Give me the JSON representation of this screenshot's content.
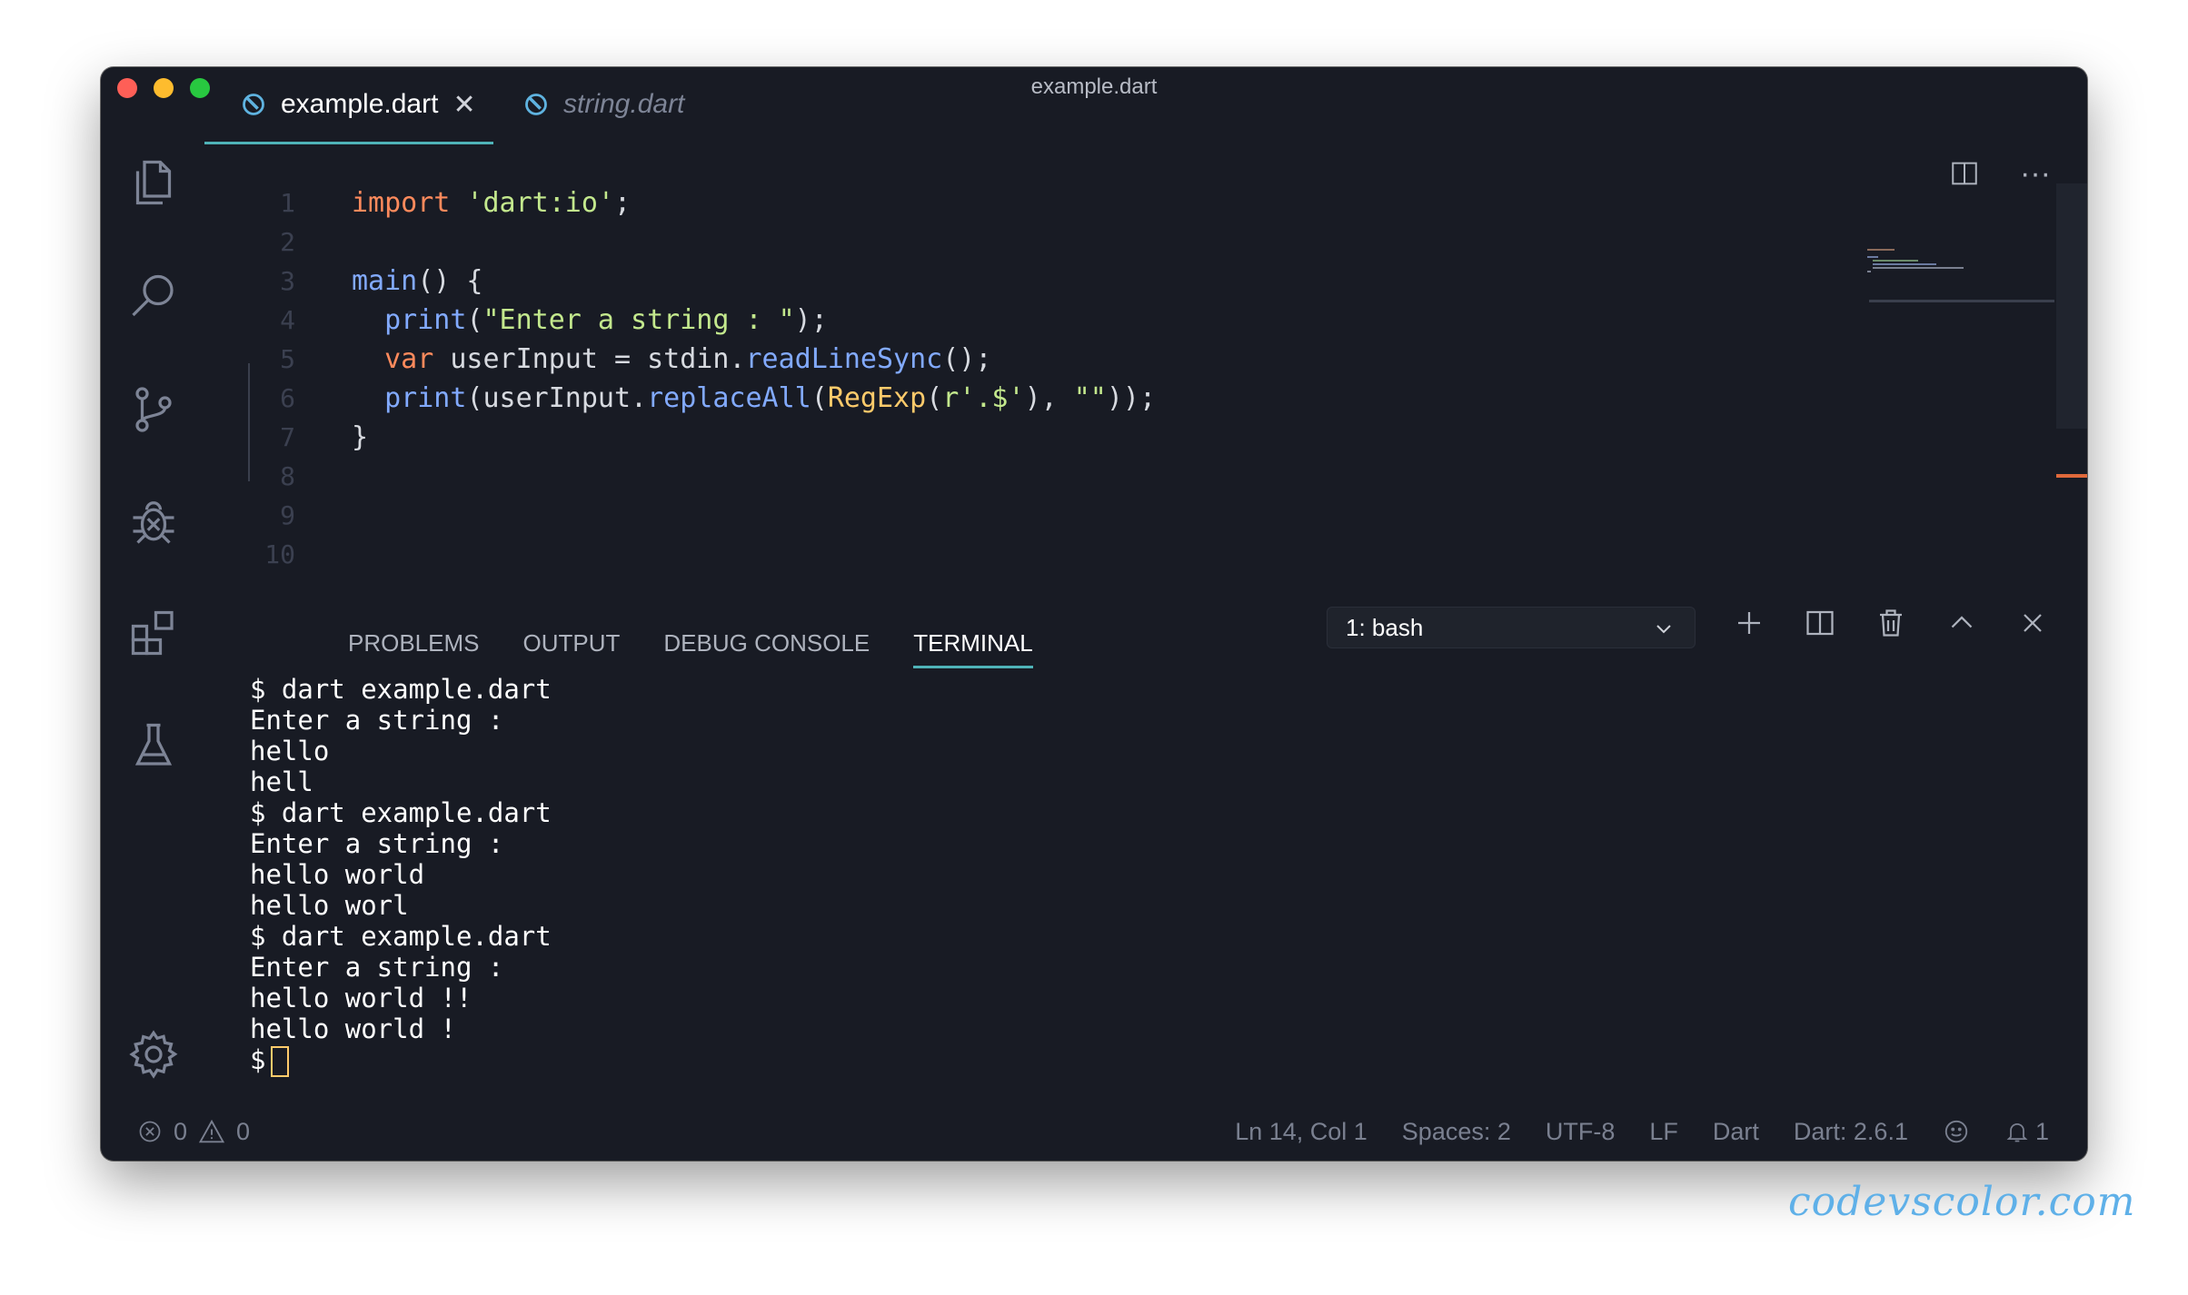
{
  "window": {
    "title": "example.dart"
  },
  "activity_bar": [
    "files-icon",
    "search-icon",
    "source-control-icon",
    "debug-icon",
    "extensions-icon",
    "testing-icon",
    "gear-icon"
  ],
  "tabs": [
    {
      "label": "example.dart",
      "active": true
    },
    {
      "label": "string.dart",
      "active": false
    }
  ],
  "editor": {
    "line_numbers": [
      "1",
      "2",
      "3",
      "4",
      "5",
      "6",
      "7",
      "8",
      "9",
      "10"
    ],
    "code": [
      "import 'dart:io';",
      "",
      "main() {",
      "  print(\"Enter a string : \");",
      "  var userInput = stdin.readLineSync();",
      "  print(userInput.replaceAll(RegExp(r'.$'), \"\"));",
      "}",
      "",
      "",
      ""
    ]
  },
  "panel": {
    "tabs": [
      "PROBLEMS",
      "OUTPUT",
      "DEBUG CONSOLE",
      "TERMINAL"
    ],
    "active_tab": "TERMINAL",
    "terminal_select": "1: bash"
  },
  "terminal": {
    "lines": [
      "$ dart example.dart",
      "Enter a string :",
      "hello",
      "hell",
      "$ dart example.dart",
      "Enter a string :",
      "hello world",
      "hello worl",
      "$ dart example.dart",
      "Enter a string :",
      "hello world !!",
      "hello world !"
    ],
    "prompt": "$"
  },
  "status": {
    "errors": "0",
    "warnings": "0",
    "position": "Ln 14, Col 1",
    "spaces": "Spaces: 2",
    "encoding": "UTF-8",
    "eol": "LF",
    "language": "Dart",
    "sdk": "Dart: 2.6.1",
    "notifications": "1"
  },
  "watermark": "codevscolor.com",
  "colors": {
    "background": "#181b24",
    "accent": "#4fb3b8",
    "keyword": "#ff8a5c",
    "string": "#c3e88d",
    "function": "#82aaff",
    "class": "#ffcb6b"
  }
}
